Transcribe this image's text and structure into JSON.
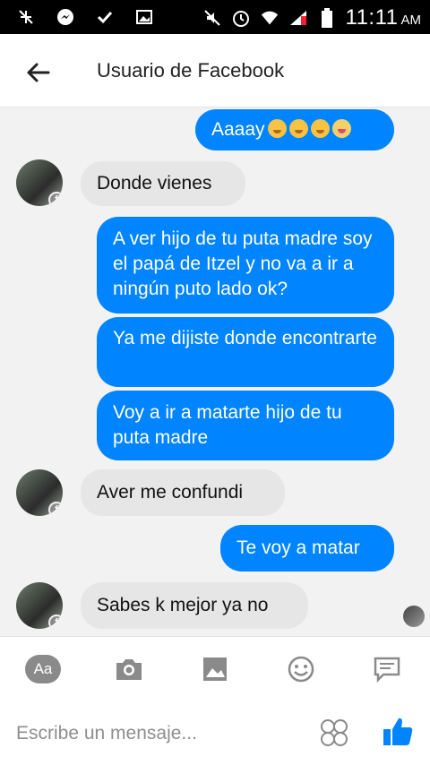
{
  "status_bar": {
    "time": "11:11",
    "ampm": "AM"
  },
  "header": {
    "title": "Usuario de Facebook"
  },
  "messages": [
    {
      "side": "out",
      "text": "Aaaay"
    },
    {
      "side": "in",
      "text": "Donde vienes"
    },
    {
      "side": "out",
      "text": "A ver hijo de tu puta madre soy el papá de Itzel y no va a ir a ningún puto lado ok?"
    },
    {
      "side": "out",
      "text": "Ya me dijiste donde encontrarte"
    },
    {
      "side": "out",
      "text": "Voy a ir a matarte hijo de tu puta madre"
    },
    {
      "side": "in",
      "text": "Aver me confundi"
    },
    {
      "side": "out",
      "text": "Te voy a matar"
    },
    {
      "side": "in",
      "text": "Sabes k mejor ya no"
    }
  ],
  "composer": {
    "aa_label": "Aa",
    "placeholder": "Escribe un mensaje..."
  },
  "colors": {
    "outgoing": "#0084ff",
    "incoming": "#e6e6e6",
    "like": "#0084ff"
  },
  "icons": [
    "back-arrow-icon",
    "camera-icon",
    "image-icon",
    "emoji-icon",
    "chat-icon",
    "sticker-icon",
    "thumbs-up-icon"
  ]
}
